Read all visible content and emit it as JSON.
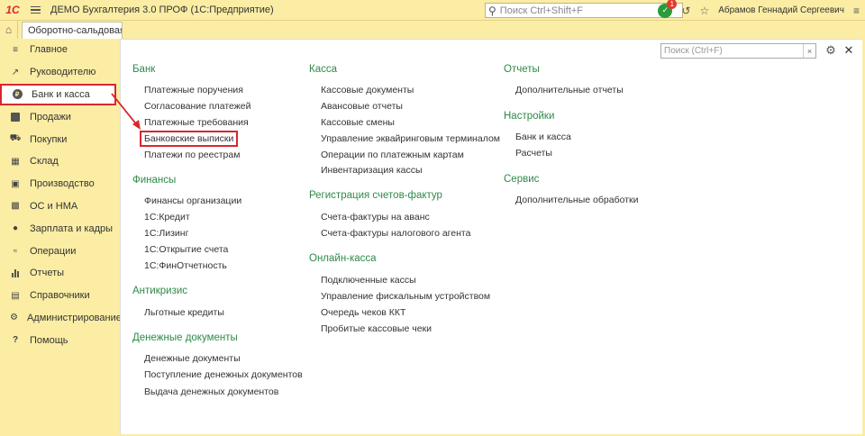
{
  "topbar": {
    "logo": "1С",
    "title": "ДЕМО Бухгалтерия 3.0 ПРОФ  (1С:Предприятие)",
    "search_placeholder": "Поиск Ctrl+Shift+F",
    "notifications_count": "1",
    "user": "Абрамов Геннадий Сергеевич"
  },
  "tabs": [
    {
      "label": "Оборотно-сальдовая в..."
    }
  ],
  "sidebar": {
    "items": [
      {
        "label": "Главное",
        "icon": "hamburger-icon"
      },
      {
        "label": "Руководителю",
        "icon": "trend-icon"
      },
      {
        "label": "Банк и касса",
        "icon": "ruble-icon",
        "active": true
      },
      {
        "label": "Продажи",
        "icon": "cart-icon"
      },
      {
        "label": "Покупки",
        "icon": "basket-icon"
      },
      {
        "label": "Склад",
        "icon": "warehouse-icon"
      },
      {
        "label": "Производство",
        "icon": "factory-icon"
      },
      {
        "label": "ОС и НМА",
        "icon": "truck-icon"
      },
      {
        "label": "Зарплата и кадры",
        "icon": "people-icon"
      },
      {
        "label": "Операции",
        "icon": "operations-icon"
      },
      {
        "label": "Отчеты",
        "icon": "chart-icon"
      },
      {
        "label": "Справочники",
        "icon": "book-icon"
      },
      {
        "label": "Администрирование",
        "icon": "gear-icon"
      },
      {
        "label": "Помощь",
        "icon": "question-icon"
      }
    ]
  },
  "panel": {
    "search_placeholder": "Поиск (Ctrl+F)",
    "columns": [
      {
        "sections": [
          {
            "title": "Банк",
            "links": [
              "Платежные поручения",
              "Согласование платежей",
              "Платежные требования",
              "Банковские выписки",
              "Платежи по реестрам"
            ]
          },
          {
            "title": "Финансы",
            "links": [
              "Финансы организации",
              "1С:Кредит",
              "1С:Лизинг",
              "1С:Открытие счета",
              "1С:ФинОтчетность"
            ]
          },
          {
            "title": "Антикризис",
            "links": [
              "Льготные кредиты"
            ]
          },
          {
            "title": "Денежные документы",
            "links": [
              "Денежные документы",
              "Поступление денежных документов",
              "Выдача денежных документов"
            ]
          }
        ]
      },
      {
        "sections": [
          {
            "title": "Касса",
            "links": [
              "Кассовые документы",
              "Авансовые отчеты",
              "Кассовые смены",
              "Управление эквайринговым терминалом",
              "Операции по платежным картам",
              "Инвентаризация кассы"
            ]
          },
          {
            "title": "Регистрация счетов-фактур",
            "links": [
              "Счета-фактуры на аванс",
              "Счета-фактуры налогового агента"
            ]
          },
          {
            "title": "Онлайн-касса",
            "links": [
              "Подключенные кассы",
              "Управление фискальным устройством",
              "Очередь чеков ККТ",
              "Пробитые кассовые чеки"
            ]
          }
        ]
      },
      {
        "sections": [
          {
            "title": "Отчеты",
            "links": [
              "Дополнительные отчеты"
            ]
          },
          {
            "title": "Настройки",
            "links": [
              "Банк и касса",
              "Расчеты"
            ]
          },
          {
            "title": "Сервис",
            "links": [
              "Дополнительные обработки"
            ]
          }
        ]
      }
    ]
  },
  "colors": {
    "sidebar_bg": "#fbeda4",
    "section_title": "#2e8a4a",
    "highlight": "#d9272e"
  }
}
